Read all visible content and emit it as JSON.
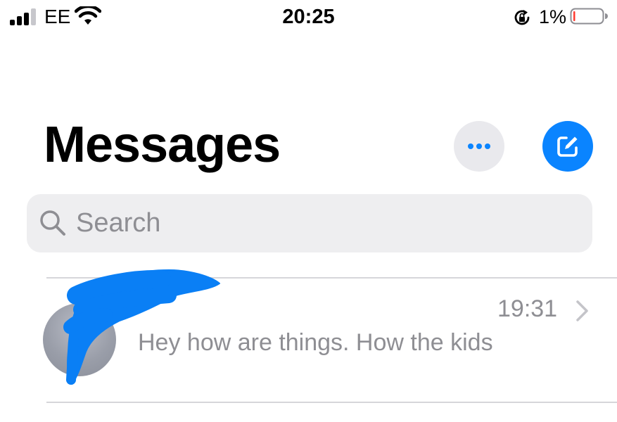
{
  "status_bar": {
    "carrier": "EE",
    "time": "20:25",
    "battery_percent": "1%",
    "battery_level": 0.01,
    "icons": [
      "signal-icon",
      "wifi-icon",
      "rotation-lock-icon",
      "battery-icon"
    ]
  },
  "header": {
    "title": "Messages",
    "more_button_icon": "ellipsis-icon",
    "compose_button_icon": "compose-icon"
  },
  "search": {
    "placeholder": "Search",
    "icon": "search-icon"
  },
  "conversations": [
    {
      "name": "",
      "time": "19:31",
      "preview": "Hey how are things. How the kids",
      "avatar": "avatar-placeholder",
      "redacted": true
    }
  ],
  "colors": {
    "accent": "#0a84ff",
    "secondary_text": "#8e8e93",
    "search_background": "#eeeef0",
    "more_button_background": "#e9e9ed",
    "battery_low": "#ff3b30",
    "redaction": "#0a7ff5"
  }
}
